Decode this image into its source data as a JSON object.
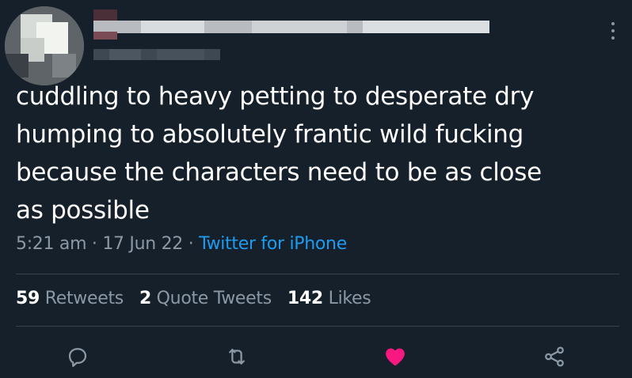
{
  "tweet": {
    "text": "cuddling to heavy petting to desperate dry\nhumping to absolutely frantic wild fucking\nbecause the characters need to be as close\nas possible",
    "time": "5:21 am",
    "date": "17 Jun 22",
    "separator": "·",
    "source": "Twitter for iPhone"
  },
  "stats": {
    "retweets_count": "59",
    "retweets_label": "Retweets",
    "quotes_count": "2",
    "quotes_label": "Quote Tweets",
    "likes_count": "142",
    "likes_label": "Likes"
  },
  "actions": {
    "reply_icon": "reply-icon",
    "retweet_icon": "retweet-icon",
    "like_icon": "heart-icon",
    "share_icon": "share-icon",
    "like_color": "#f91880"
  },
  "colors": {
    "background": "#15202b",
    "text": "#ffffff",
    "muted": "#8b98a5",
    "link": "#1d9bf0"
  }
}
